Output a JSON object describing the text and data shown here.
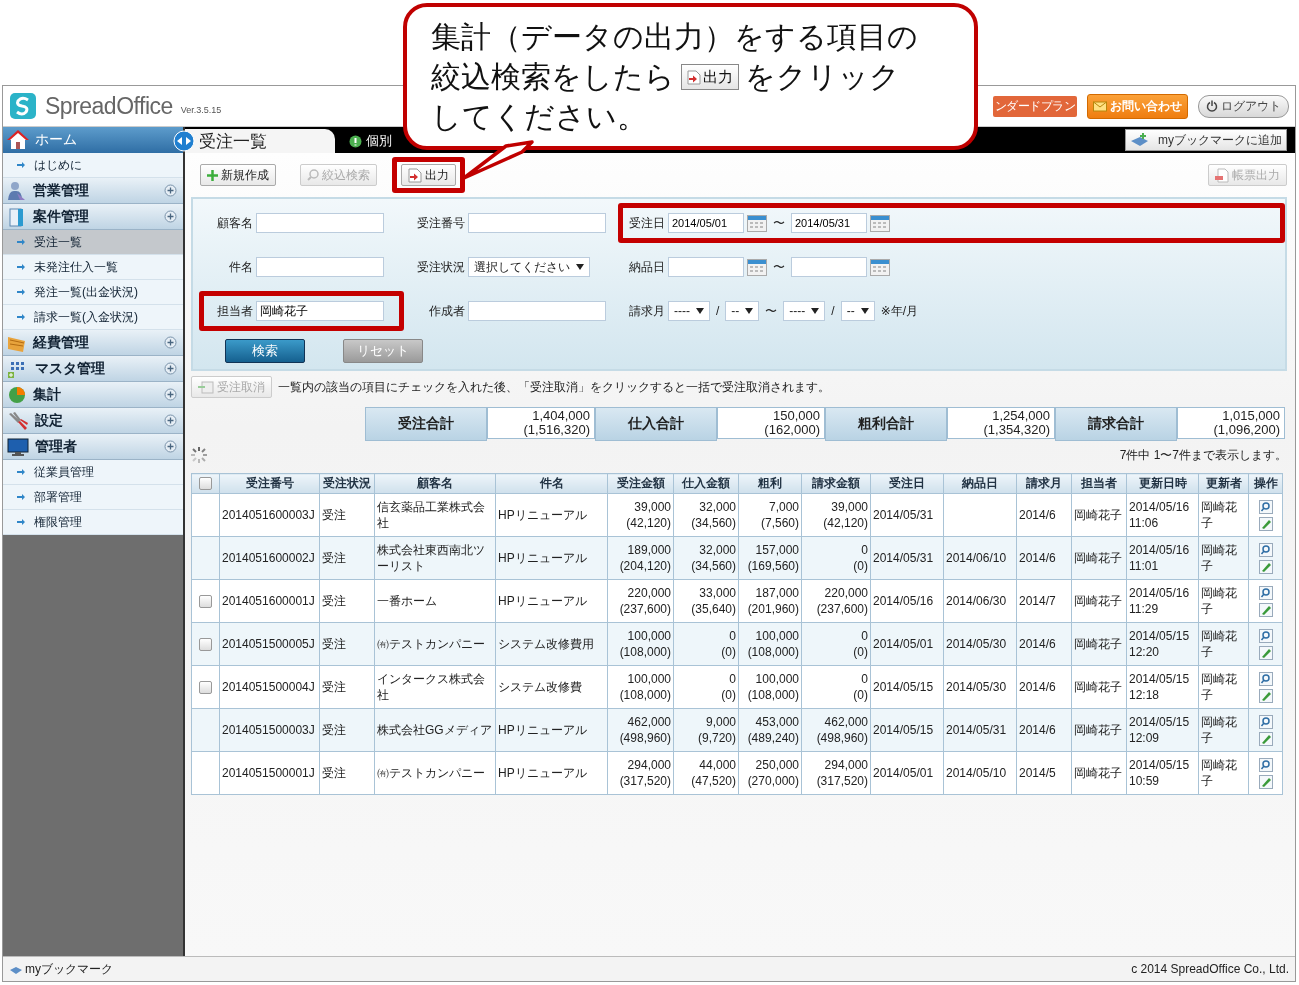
{
  "callout": {
    "line_1": "集計（データの出力）をする項目の",
    "line_2_before": "絞込検索をしたら",
    "line_2_button": "出力",
    "line_2_after": "をクリック",
    "line_3": "してください。"
  },
  "header": {
    "logo": "SpreadOffice",
    "version": "Ver.3.5.15",
    "plan": "ンダードプラン",
    "contact": "お問い合わせ",
    "logout": "ログアウト"
  },
  "nav": {
    "tabs": [
      {
        "label": "受注一覧",
        "selected": true
      },
      {
        "label": "個別",
        "selected": false
      }
    ],
    "bookmark_add": "myブックマークに追加"
  },
  "sidebar": {
    "items": [
      {
        "kind": "home",
        "label": "ホーム",
        "children": [
          {
            "label": "はじめに",
            "selected": false
          }
        ]
      },
      {
        "kind": "group",
        "label": "営業管理"
      },
      {
        "kind": "group",
        "label": "案件管理",
        "children": [
          {
            "label": "受注一覧",
            "selected": true
          },
          {
            "label": "未発注仕入一覧",
            "selected": false
          },
          {
            "label": "発注一覧(出金状況)",
            "selected": false
          },
          {
            "label": "請求一覧(入金状況)",
            "selected": false
          }
        ]
      },
      {
        "kind": "group",
        "label": "経費管理"
      },
      {
        "kind": "group",
        "label": "マスタ管理"
      },
      {
        "kind": "group",
        "label": "集計"
      },
      {
        "kind": "group",
        "label": "設定"
      },
      {
        "kind": "group",
        "label": "管理者",
        "children": [
          {
            "label": "従業員管理",
            "selected": false
          },
          {
            "label": "部署管理",
            "selected": false
          },
          {
            "label": "権限管理",
            "selected": false
          }
        ]
      }
    ]
  },
  "toolbar": {
    "buttons": [
      {
        "label": "新規作成",
        "disabled": false,
        "highlighted": false
      },
      {
        "label": "絞込検索",
        "disabled": true,
        "highlighted": false
      },
      {
        "label": "出力",
        "disabled": false,
        "highlighted": true
      }
    ],
    "report": {
      "label": "帳票出力",
      "disabled": true
    }
  },
  "filters": [
    {
      "kind": "text",
      "label": "顧客名",
      "highlighted": false
    },
    {
      "kind": "text",
      "label": "受注番号",
      "highlighted": false
    },
    {
      "kind": "date_range",
      "label": "受注日",
      "from": "2014/05/01",
      "separator": "〜",
      "to": "2014/05/31",
      "highlighted": true
    },
    {
      "kind": "text",
      "label": "件名",
      "highlighted": false
    },
    {
      "kind": "select",
      "label": "受注状況",
      "value": "選択してください",
      "highlighted": false
    },
    {
      "kind": "date_range",
      "label": "納品日",
      "separator": "〜",
      "highlighted": false
    },
    {
      "kind": "text",
      "label": "担当者",
      "value": "岡崎花子",
      "highlighted": true
    },
    {
      "kind": "text",
      "label": "作成者",
      "highlighted": false
    },
    {
      "kind": "month_range",
      "label": "請求月",
      "highlighted": false,
      "parts": [
        {
          "kind": "select",
          "text": "----"
        },
        {
          "kind": "sep",
          "text": "/"
        },
        {
          "kind": "select",
          "text": "--"
        },
        {
          "kind": "sep",
          "text": "〜"
        },
        {
          "kind": "select",
          "text": "----"
        },
        {
          "kind": "sep",
          "text": "/"
        },
        {
          "kind": "select",
          "text": "--"
        },
        {
          "kind": "sep",
          "text": "※年/月"
        }
      ]
    }
  ],
  "filter_buttons": {
    "search": "検索",
    "reset": "リセット"
  },
  "cancel": {
    "label": "受注取消",
    "disabled": true,
    "note": "一覧内の該当の項目にチェックを入れた後、「受注取消」をクリックすると一括で受注取消されます。"
  },
  "totals": [
    {
      "label": "受注合計",
      "value": "1,404,000",
      "value_tax": "(1,516,320)"
    },
    {
      "label": "仕入合計",
      "value": "150,000",
      "value_tax": "(162,000)"
    },
    {
      "label": "粗利合計",
      "value": "1,254,000",
      "value_tax": "(1,354,320)"
    },
    {
      "label": "請求合計",
      "value": "1,015,000",
      "value_tax": "(1,096,200)"
    }
  ],
  "count": "7件中 1〜7件まで表示します。",
  "table": {
    "header_checked": false,
    "columns": [
      "受注番号",
      "受注状況",
      "顧客名",
      "件名",
      "受注金額",
      "仕入金額",
      "粗利",
      "請求金額",
      "受注日",
      "納品日",
      "請求月",
      "担当者",
      "更新日時",
      "更新者",
      "操作"
    ],
    "rows": [
      {
        "number": "2014051600003J",
        "status": "受注",
        "customer": "信玄薬品工業株式会社",
        "subject": "HPリニューアル",
        "order": [
          "39,000",
          "(42,120)"
        ],
        "purchase": [
          "32,000",
          "(34,560)"
        ],
        "profit": [
          "7,000",
          "(7,560)"
        ],
        "billing": [
          "39,000",
          "(42,120)"
        ],
        "order_date": "2014/05/31",
        "delivery_date": "",
        "bill_month": "2014/6",
        "assignee": "岡崎花子",
        "updated_at": "2014/05/16 11:06",
        "updated_by": "岡崎花子"
      },
      {
        "number": "2014051600002J",
        "status": "受注",
        "customer": "株式会社東西南北ツーリスト",
        "subject": "HPリニューアル",
        "order": [
          "189,000",
          "(204,120)"
        ],
        "purchase": [
          "32,000",
          "(34,560)"
        ],
        "profit": [
          "157,000",
          "(169,560)"
        ],
        "billing": [
          "0",
          "(0)"
        ],
        "order_date": "2014/05/31",
        "delivery_date": "2014/06/10",
        "bill_month": "2014/6",
        "assignee": "岡崎花子",
        "updated_at": "2014/05/16 11:01",
        "updated_by": "岡崎花子"
      },
      {
        "checkbox": {
          "checked": false
        },
        "number": "2014051600001J",
        "status": "受注",
        "customer": "一番ホーム",
        "subject": "HPリニューアル",
        "order": [
          "220,000",
          "(237,600)"
        ],
        "purchase": [
          "33,000",
          "(35,640)"
        ],
        "profit": [
          "187,000",
          "(201,960)"
        ],
        "billing": [
          "220,000",
          "(237,600)"
        ],
        "order_date": "2014/05/16",
        "delivery_date": "2014/06/30",
        "bill_month": "2014/7",
        "assignee": "岡崎花子",
        "updated_at": "2014/05/16 11:29",
        "updated_by": "岡崎花子"
      },
      {
        "checkbox": {
          "checked": false
        },
        "number": "2014051500005J",
        "status": "受注",
        "customer": "㈲テストカンパニー",
        "subject": "システム改修費用",
        "order": [
          "100,000",
          "(108,000)"
        ],
        "purchase": [
          "0",
          "(0)"
        ],
        "profit": [
          "100,000",
          "(108,000)"
        ],
        "billing": [
          "0",
          "(0)"
        ],
        "order_date": "2014/05/01",
        "delivery_date": "2014/05/30",
        "bill_month": "2014/6",
        "assignee": "岡崎花子",
        "updated_at": "2014/05/15 12:20",
        "updated_by": "岡崎花子"
      },
      {
        "checkbox": {
          "checked": false
        },
        "number": "2014051500004J",
        "status": "受注",
        "customer": "インタークス株式会社",
        "subject": "システム改修費",
        "order": [
          "100,000",
          "(108,000)"
        ],
        "purchase": [
          "0",
          "(0)"
        ],
        "profit": [
          "100,000",
          "(108,000)"
        ],
        "billing": [
          "0",
          "(0)"
        ],
        "order_date": "2014/05/15",
        "delivery_date": "2014/05/30",
        "bill_month": "2014/6",
        "assignee": "岡崎花子",
        "updated_at": "2014/05/15 12:18",
        "updated_by": "岡崎花子"
      },
      {
        "number": "2014051500003J",
        "status": "受注",
        "customer": "株式会社GGメディア",
        "subject": "HPリニューアル",
        "order": [
          "462,000",
          "(498,960)"
        ],
        "purchase": [
          "9,000",
          "(9,720)"
        ],
        "profit": [
          "453,000",
          "(489,240)"
        ],
        "billing": [
          "462,000",
          "(498,960)"
        ],
        "order_date": "2014/05/15",
        "delivery_date": "2014/05/31",
        "bill_month": "2014/6",
        "assignee": "岡崎花子",
        "updated_at": "2014/05/15 12:09",
        "updated_by": "岡崎花子"
      },
      {
        "number": "2014051500001J",
        "status": "受注",
        "customer": "㈲テストカンパニー",
        "subject": "HPリニューアル",
        "order": [
          "294,000",
          "(317,520)"
        ],
        "purchase": [
          "44,000",
          "(47,520)"
        ],
        "profit": [
          "250,000",
          "(270,000)"
        ],
        "billing": [
          "294,000",
          "(317,520)"
        ],
        "order_date": "2014/05/01",
        "delivery_date": "2014/05/10",
        "bill_month": "2014/5",
        "assignee": "岡崎花子",
        "updated_at": "2014/05/15 10:59",
        "updated_by": "岡崎花子"
      }
    ]
  },
  "footer": {
    "bookmarks": "myブックマーク",
    "copyright": "c 2014 SpreadOffice Co., Ltd."
  }
}
